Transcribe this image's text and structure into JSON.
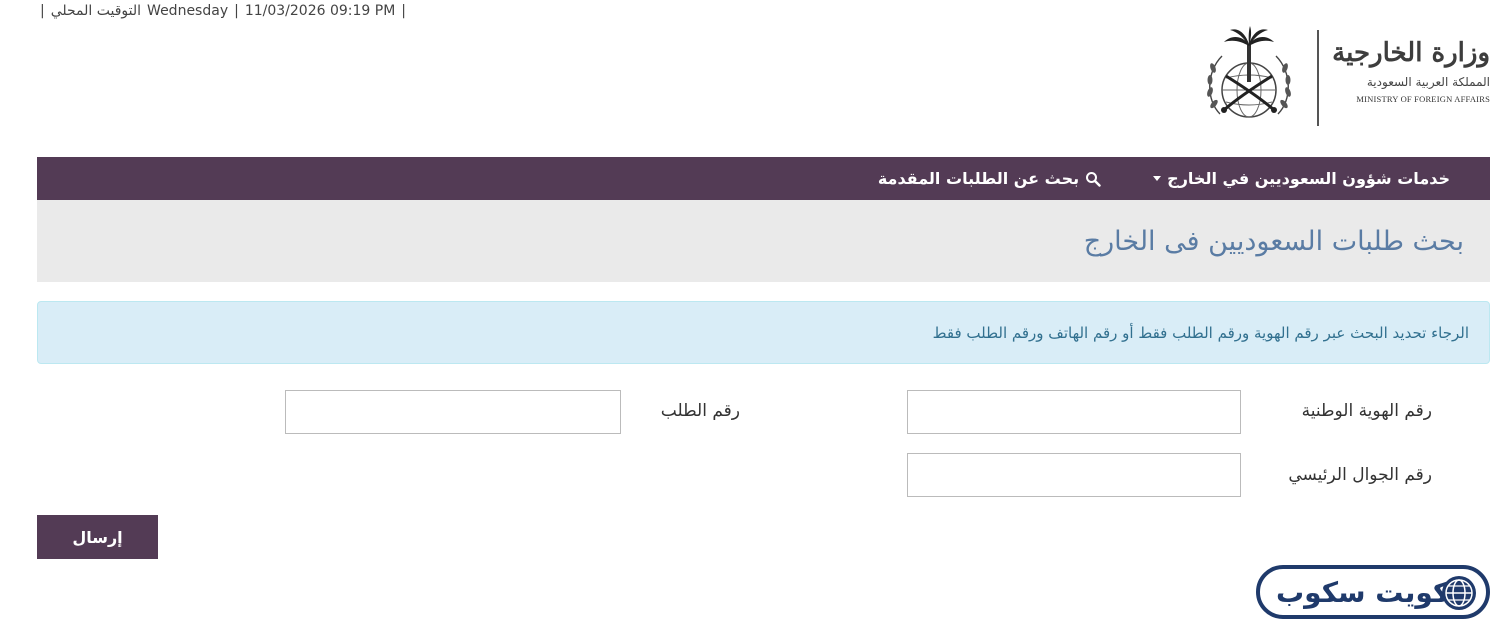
{
  "topbar": {
    "separator": "|",
    "local_time_label": "التوقيت المحلي",
    "weekday": "Wednesday",
    "datetime": "11/03/2026 09:19 PM"
  },
  "logo": {
    "ar_main": "وزارة الخارجية",
    "ar_sub": "المملكة العربية السعودية",
    "en": "MINISTRY OF FOREIGN AFFAIRS"
  },
  "nav": {
    "items": [
      {
        "label": "خدمات شؤون السعوديين في الخارج",
        "has_dropdown": true
      },
      {
        "label": "بحث عن الطلبات المقدمة",
        "icon": "search-icon"
      }
    ]
  },
  "page": {
    "title": "بحث طلبات السعوديين فى الخارج"
  },
  "alert": {
    "text": "الرجاء تحديد البحث عبر رقم الهوية ورقم الطلب فقط أو رقم الهاتف ورقم الطلب فقط"
  },
  "form": {
    "national_id_label": "رقم الهوية الوطنية",
    "national_id_value": "",
    "request_number_label": "رقم الطلب",
    "request_number_value": "",
    "mobile_label": "رقم الجوال الرئيسي",
    "mobile_value": "",
    "submit_label": "إرسال"
  },
  "watermark": {
    "text": "كويت سكوب"
  },
  "colors": {
    "brand_purple": "#533b55",
    "title_blue": "#5a7ca4",
    "alert_bg": "#d9edf7",
    "alert_text": "#31708f",
    "watermark_blue": "#1f3a6b"
  }
}
